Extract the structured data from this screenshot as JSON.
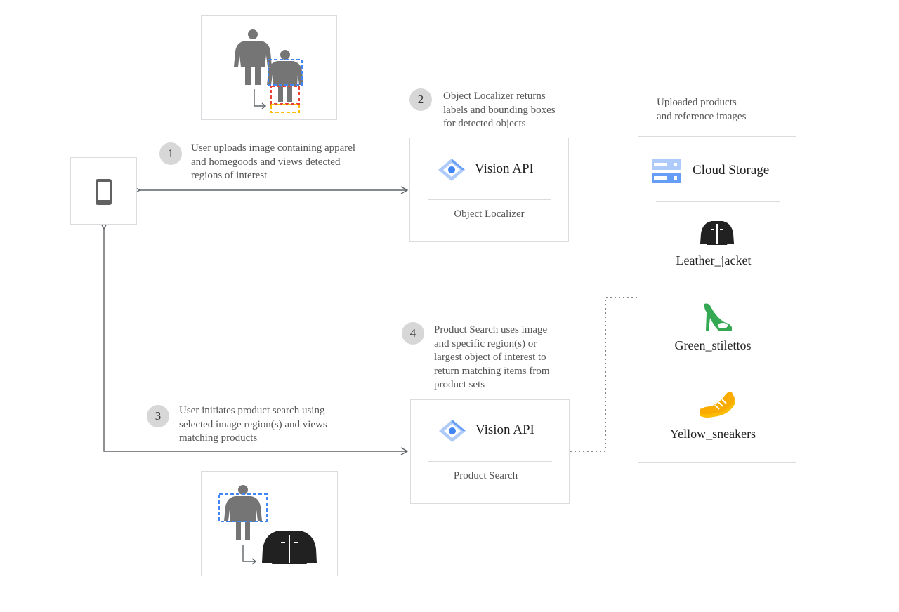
{
  "steps": [
    {
      "number": "1",
      "text": [
        "User uploads image containing apparel",
        "and homegoods and views detected",
        "regions of interest"
      ]
    },
    {
      "number": "2",
      "text": [
        "Object Localizer returns",
        "labels and bounding boxes",
        "for detected objects"
      ]
    },
    {
      "number": "3",
      "text": [
        "User initiates product search using",
        "selected image region(s) and views",
        "matching products"
      ]
    },
    {
      "number": "4",
      "text": [
        "Product Search uses image",
        "and specific region(s) or",
        "largest object of interest to",
        "return matching items from",
        "product sets"
      ]
    }
  ],
  "services": {
    "localizer": {
      "title": "Vision API",
      "subtitle": "Object Localizer"
    },
    "search": {
      "title": "Vision API",
      "subtitle": "Product Search"
    }
  },
  "storage": {
    "heading": [
      "Uploaded products",
      "and reference images"
    ],
    "title": "Cloud Storage",
    "products": [
      {
        "label": "Leather_jacket",
        "icon": "leather-jacket-icon",
        "color": "#212121"
      },
      {
        "label": "Green_stilettos",
        "icon": "green-stiletto-icon",
        "color": "#34a853"
      },
      {
        "label": "Yellow_sneakers",
        "icon": "yellow-sneaker-icon",
        "color": "#f9ab00"
      }
    ]
  },
  "colors": {
    "vision_blue": "#4285f4",
    "person_gray": "#757575",
    "box_blue": "#4285f4",
    "box_red": "#ea4335",
    "box_yellow": "#fbbc04"
  }
}
